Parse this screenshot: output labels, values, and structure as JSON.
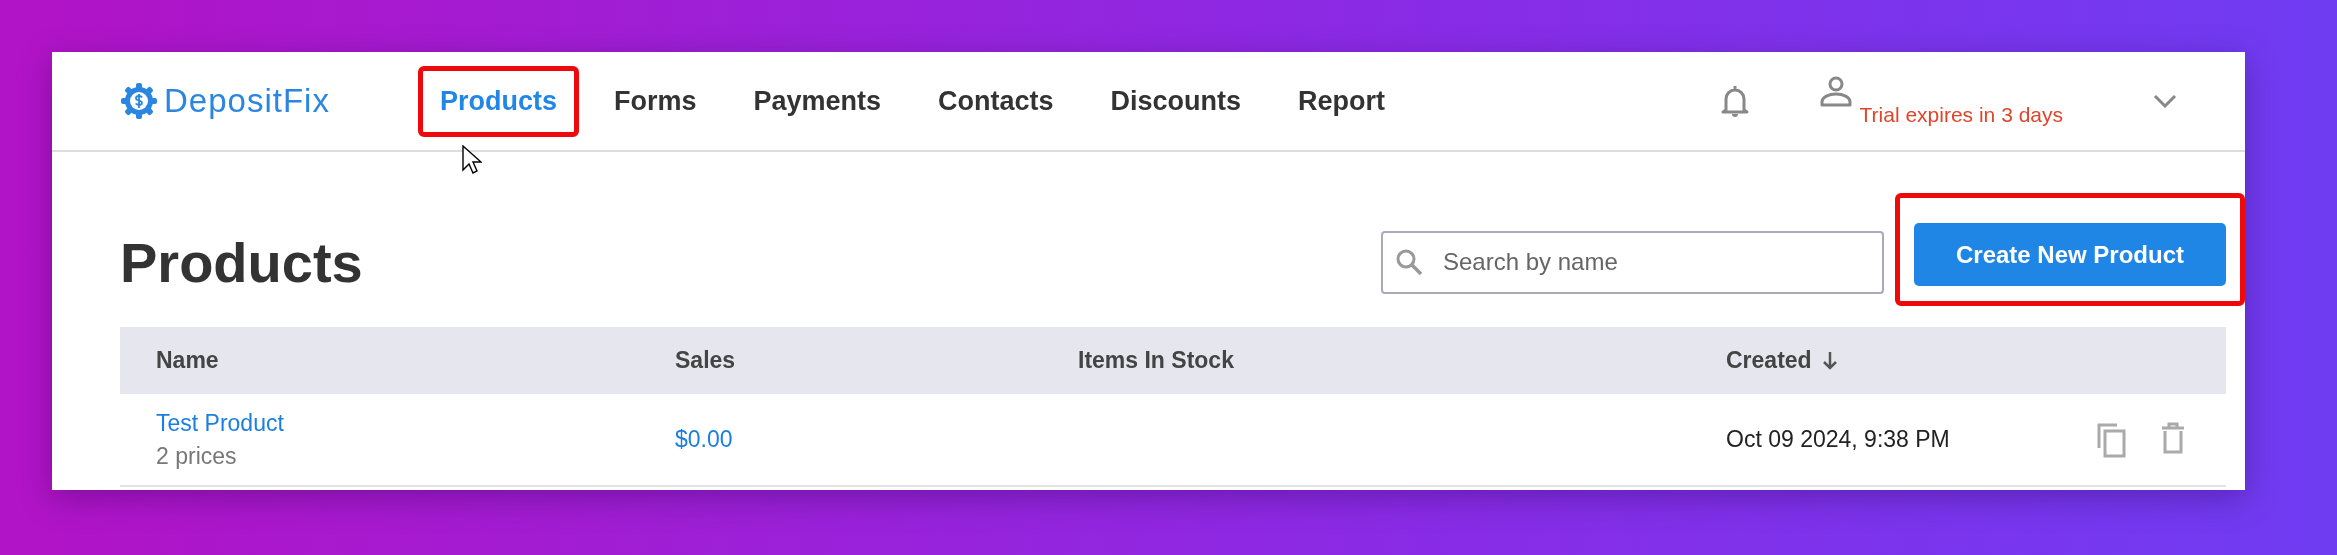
{
  "header": {
    "logo": "DepositFix",
    "nav": [
      {
        "label": "Products",
        "selected": true,
        "highlighted": true
      },
      {
        "label": "Forms",
        "selected": false,
        "highlighted": false
      },
      {
        "label": "Payments",
        "selected": false,
        "highlighted": false
      },
      {
        "label": "Contacts",
        "selected": false,
        "highlighted": false
      },
      {
        "label": "Discounts",
        "selected": false,
        "highlighted": false
      },
      {
        "label": "Report",
        "selected": false,
        "highlighted": false
      }
    ],
    "trial_notice": "Trial expires in 3 days"
  },
  "page": {
    "title": "Products",
    "search": {
      "placeholder": "Search by name"
    },
    "create_button": {
      "label": "Create New Product",
      "highlighted": true
    }
  },
  "table": {
    "columns": [
      {
        "label": "Name",
        "sorted": false
      },
      {
        "label": "Sales",
        "sorted": false
      },
      {
        "label": "Items In Stock",
        "sorted": false
      },
      {
        "label": "Created",
        "sorted": true
      }
    ],
    "rows": [
      {
        "name": "Test Product",
        "prices": "2 prices",
        "sales": "$0.00",
        "created": "Oct 09 2024, 9:38 PM"
      }
    ]
  }
}
